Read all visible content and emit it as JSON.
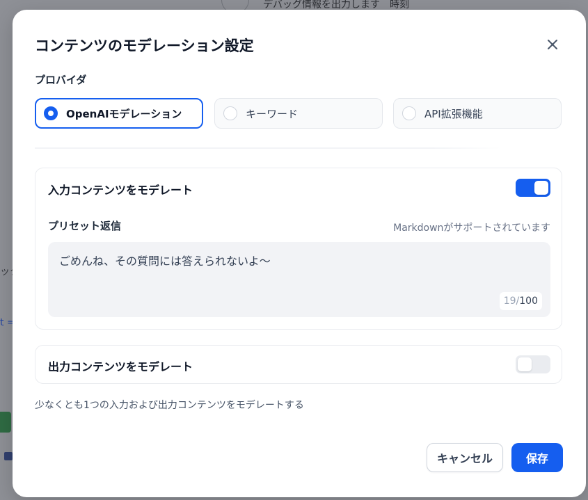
{
  "background": {
    "top_text": "デバッグ情報を出力します　時刻",
    "left_text_1": "ック",
    "left_text_2": "t ="
  },
  "modal": {
    "title": "コンテンツのモデレーション設定",
    "close_icon": "close-icon"
  },
  "provider": {
    "label": "プロバイダ",
    "options": [
      {
        "label": "OpenAIモデレーション",
        "selected": true
      },
      {
        "label": "キーワード",
        "selected": false
      },
      {
        "label": "API拡張機能",
        "selected": false
      }
    ]
  },
  "input_moderation": {
    "title": "入力コンテンツをモデレート",
    "enabled": true,
    "preset_label": "プリセット返信",
    "markdown_hint": "Markdownがサポートされています",
    "preset_text": "ごめんね、その質問には答えられないよ〜",
    "count": "19",
    "max": "100"
  },
  "output_moderation": {
    "title": "出力コンテンツをモデレート",
    "enabled": false
  },
  "note": "少なくとも1つの入力および出力コンテンツをモデレートする",
  "buttons": {
    "cancel": "キャンセル",
    "save": "保存"
  },
  "colors": {
    "accent": "#155eef",
    "toggle_off": "#eaecf0"
  }
}
